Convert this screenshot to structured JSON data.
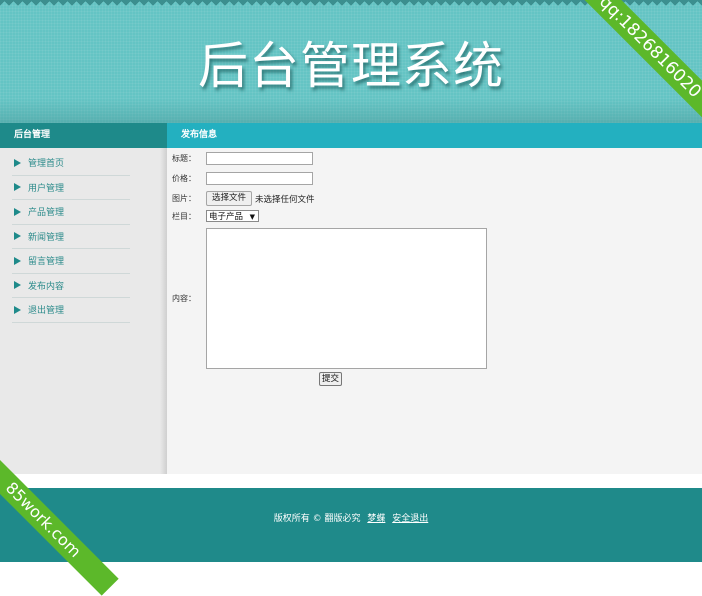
{
  "header": {
    "title": "后台管理系统"
  },
  "ribbons": {
    "top_right": "qq:1826816020",
    "bottom_left": "85work.com"
  },
  "sidebar": {
    "title": "后台管理",
    "items": [
      {
        "label": "管理首页"
      },
      {
        "label": "用户管理"
      },
      {
        "label": "产品管理"
      },
      {
        "label": "新闻管理"
      },
      {
        "label": "留言管理"
      },
      {
        "label": "发布内容"
      },
      {
        "label": "退出管理"
      }
    ]
  },
  "main": {
    "title": "发布信息",
    "form": {
      "title_label": "标题：",
      "title_value": "",
      "price_label": "价格：",
      "price_value": "",
      "image_label": "图片：",
      "file_button": "选择文件",
      "file_status": "未选择任何文件",
      "column_label": "栏目：",
      "column_selected": "电子产品",
      "content_label": "内容：",
      "content_value": "",
      "submit_label": "提交"
    }
  },
  "footer": {
    "copyright": "版权所有 © 翻版必究",
    "author_link": "梦蝶",
    "logout_link": "安全退出"
  },
  "colors": {
    "header_bg": "#64c4c4",
    "sidebar_head_bg": "#1e8a8a",
    "main_head_bg": "#23b0c0",
    "footer_bg": "#1f8a8a",
    "ribbon_bg": "#5cb82a"
  }
}
